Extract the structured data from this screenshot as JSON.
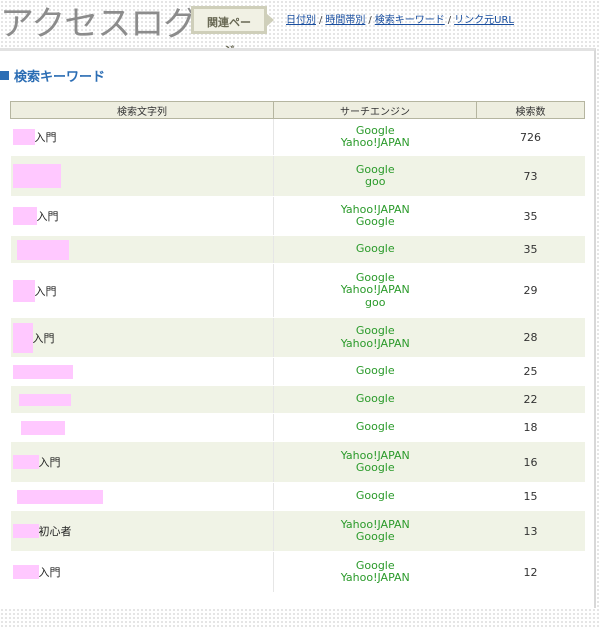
{
  "header": {
    "site_title": "アクセスログ",
    "related_label": "関連ページ",
    "nav": [
      "日付別",
      "時間帯別",
      "検索キーワード",
      "リンク元URL"
    ]
  },
  "section": {
    "title": "検索キーワード"
  },
  "table": {
    "columns": [
      "検索文字列",
      "サーチエンジン",
      "検索数"
    ],
    "rows": [
      {
        "keyword": "入門",
        "engines": [
          "Google",
          "Yahoo!JAPAN"
        ],
        "count": "726"
      },
      {
        "keyword": "",
        "engines": [
          "Google",
          "goo"
        ],
        "count": "73"
      },
      {
        "keyword": "入門",
        "engines": [
          "Yahoo!JAPAN",
          "Google"
        ],
        "count": "35"
      },
      {
        "keyword": "",
        "engines": [
          "Google"
        ],
        "count": "35"
      },
      {
        "keyword": "入門",
        "engines": [
          "Google",
          "Yahoo!JAPAN",
          "goo"
        ],
        "count": "29"
      },
      {
        "keyword": "入門",
        "engines": [
          "Google",
          "Yahoo!JAPAN"
        ],
        "count": "28"
      },
      {
        "keyword": "",
        "engines": [
          "Google"
        ],
        "count": "25"
      },
      {
        "keyword": "",
        "engines": [
          "Google"
        ],
        "count": "22"
      },
      {
        "keyword": "",
        "engines": [
          "Google"
        ],
        "count": "18"
      },
      {
        "keyword": "入門",
        "engines": [
          "Yahoo!JAPAN",
          "Google"
        ],
        "count": "16"
      },
      {
        "keyword": "",
        "engines": [
          "Google"
        ],
        "count": "15"
      },
      {
        "keyword": "初心者",
        "engines": [
          "Yahoo!JAPAN",
          "Google"
        ],
        "count": "13"
      },
      {
        "keyword": "入門",
        "engines": [
          "Google",
          "Yahoo!JAPAN"
        ],
        "count": "12"
      }
    ]
  },
  "colors": {
    "accent": "#2b6db4",
    "engine_text": "#2a9a2a",
    "redaction": "#ffc8ff",
    "alt_row": "#f0f3e6"
  }
}
